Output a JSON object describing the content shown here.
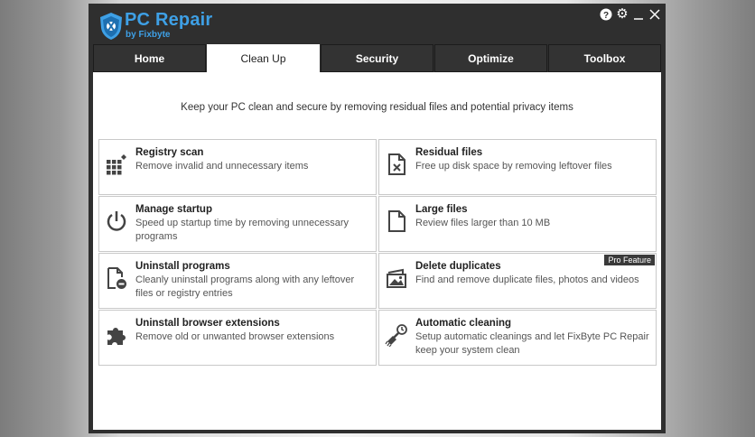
{
  "app": {
    "title": "PC Repair",
    "subtitle": "by Fixbyte"
  },
  "window_controls": {
    "help": "?",
    "settings": "⚙",
    "minimize": "—",
    "close": "✕"
  },
  "tabs": [
    {
      "label": "Home"
    },
    {
      "label": "Clean Up"
    },
    {
      "label": "Security"
    },
    {
      "label": "Optimize"
    },
    {
      "label": "Toolbox"
    }
  ],
  "active_tab": "Clean Up",
  "tagline": "Keep your PC clean and secure by removing residual files and potential privacy items",
  "cards": [
    {
      "title": "Registry scan",
      "desc": "Remove invalid and unnecessary items",
      "icon": "registry-grid-icon"
    },
    {
      "title": "Residual files",
      "desc": "Free up disk space by removing leftover files",
      "icon": "file-x-icon"
    },
    {
      "title": "Manage startup",
      "desc": "Speed up startup time by removing unnecessary programs",
      "icon": "power-icon"
    },
    {
      "title": "Large files",
      "desc": "Review files larger than 10 MB",
      "icon": "file-icon"
    },
    {
      "title": "Uninstall programs",
      "desc": "Cleanly uninstall programs along with any leftover files or registry entries",
      "icon": "file-minus-icon"
    },
    {
      "title": "Delete duplicates",
      "desc": "Find and remove duplicate files, photos and videos",
      "icon": "duplicate-photo-icon",
      "badge": "Pro Feature"
    },
    {
      "title": "Uninstall browser extensions",
      "desc": "Remove old or unwanted browser extensions",
      "icon": "puzzle-icon"
    },
    {
      "title": "Automatic cleaning",
      "desc": "Setup automatic cleanings and let FixByte PC Repair keep your system clean",
      "icon": "broom-clock-icon"
    }
  ],
  "colors": {
    "brand": "#3ea0e6",
    "window_bg": "#2f2f2f",
    "tab_active_bg": "#ffffff"
  }
}
